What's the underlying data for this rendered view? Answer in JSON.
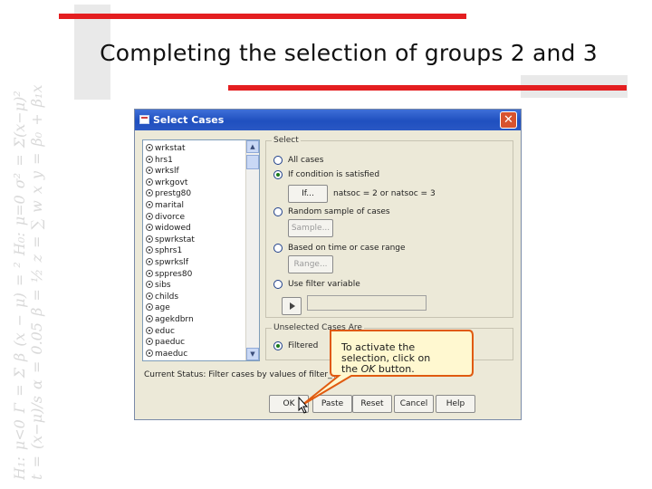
{
  "slide": {
    "title": "Completing the selection of groups 2 and 3",
    "background_formulas": "H₁: μ<0   Γ = Σ β (x − μ) = ²   H₀: μ=0   σ² = Σ(x−μ)²   t = (x−μ)/s   α = 0.05   β = ½   z = ∑ w x   y = β₀ + β₁x"
  },
  "colors": {
    "accent_red": "#e41e20",
    "titlebar_blue": "#1f4fbf",
    "callout_fill": "#fff8d0",
    "callout_border": "#e05a10"
  },
  "dialog": {
    "title": "Select Cases",
    "close_icon": "close-icon",
    "variables": [
      "wrkstat",
      "hrs1",
      "wrkslf",
      "wrkgovt",
      "prestg80",
      "marital",
      "divorce",
      "widowed",
      "spwrkstat",
      "sphrs1",
      "spwrkslf",
      "sppres80",
      "sibs",
      "childs",
      "age",
      "agekdbrn",
      "educ",
      "paeduc",
      "maeduc"
    ],
    "select_group": {
      "legend": "Select",
      "options": {
        "all_cases": "All cases",
        "if_condition": "If condition is satisfied",
        "random_sample": "Random sample of cases",
        "based_on_range": "Based on time or case range",
        "use_filter": "Use filter variable"
      },
      "selected_option": "if_condition",
      "if_button": "If...",
      "condition_text": "natsoc = 2 or natsoc = 3",
      "sample_button": "Sample...",
      "range_button": "Range..."
    },
    "unselected_group": {
      "legend": "Unselected Cases Are",
      "filtered_label": "Filtered"
    },
    "status_text": "Current Status: Filter cases by values of filter_$",
    "buttons": {
      "ok": "OK",
      "paste": "Paste",
      "reset": "Reset",
      "cancel": "Cancel",
      "help": "Help"
    }
  },
  "callout": {
    "line1": "To activate the",
    "line2": "selection, click on",
    "line3_prefix": "the ",
    "line3_italic": "OK",
    "line3_suffix": " button."
  }
}
